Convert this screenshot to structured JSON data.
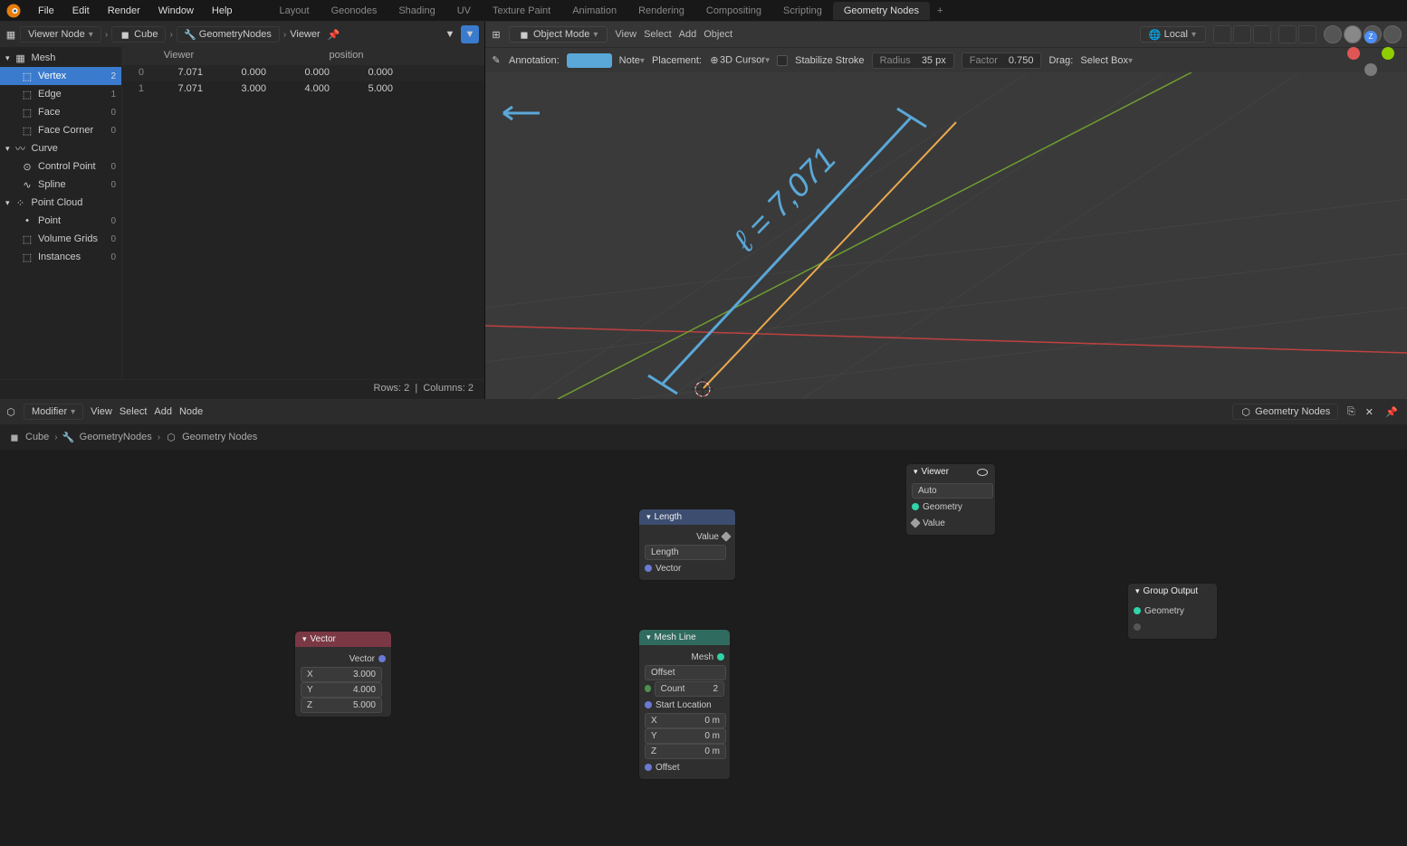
{
  "menu": {
    "items": [
      "File",
      "Edit",
      "Render",
      "Window",
      "Help"
    ]
  },
  "workspaces": {
    "tabs": [
      "Layout",
      "Geonodes",
      "Shading",
      "UV",
      "Texture Paint",
      "Animation",
      "Rendering",
      "Compositing",
      "Scripting",
      "Geometry Nodes"
    ],
    "active": 9
  },
  "spreadsheet": {
    "mode": "Viewer Node",
    "crumbs": [
      "Cube",
      "GeometryNodes",
      "Viewer"
    ],
    "tree": [
      {
        "label": "Mesh",
        "type": "cat"
      },
      {
        "label": "Vertex",
        "count": 2,
        "sel": true
      },
      {
        "label": "Edge",
        "count": 1
      },
      {
        "label": "Face",
        "count": 0
      },
      {
        "label": "Face Corner",
        "count": 0
      },
      {
        "label": "Curve",
        "type": "cat"
      },
      {
        "label": "Control Point",
        "count": 0
      },
      {
        "label": "Spline",
        "count": 0
      },
      {
        "label": "Point Cloud",
        "type": "cat"
      },
      {
        "label": "Point",
        "count": 0
      },
      {
        "label": "Volume Grids",
        "count": 0,
        "type": "solo"
      },
      {
        "label": "Instances",
        "count": 0,
        "type": "solo"
      }
    ],
    "columns": [
      "",
      "Viewer",
      "position"
    ],
    "rows": [
      {
        "i": 0,
        "viewer": "7.071",
        "x": "0.000",
        "y": "0.000",
        "z": "0.000"
      },
      {
        "i": 1,
        "viewer": "7.071",
        "x": "3.000",
        "y": "4.000",
        "z": "5.000"
      }
    ],
    "status": {
      "rows": "Rows: 2",
      "cols": "Columns: 2"
    }
  },
  "viewport": {
    "mode": "Object Mode",
    "menus": [
      "View",
      "Select",
      "Add",
      "Object"
    ],
    "orientation": "Local",
    "annotation": {
      "label": "Annotation:",
      "tool_label": "Note",
      "placement_label": "Placement:",
      "placement": "3D Cursor",
      "stabilize": "Stabilize Stroke",
      "radius_label": "Radius",
      "radius": "35 px",
      "factor_label": "Factor",
      "factor": "0.750",
      "drag_label": "Drag:",
      "drag": "Select Box"
    },
    "handwriting": "ℓ = 7,071"
  },
  "node_editor": {
    "mode": "Modifier",
    "menus": [
      "View",
      "Select",
      "Add",
      "Node"
    ],
    "tree_name": "Geometry Nodes",
    "crumbs": [
      "Cube",
      "GeometryNodes",
      "Geometry Nodes"
    ]
  },
  "nodes": {
    "vector": {
      "title": "Vector",
      "out": "Vector",
      "x": "3.000",
      "y": "4.000",
      "z": "5.000"
    },
    "length": {
      "title": "Length",
      "out": "Value",
      "op": "Length",
      "in": "Vector"
    },
    "meshline": {
      "title": "Mesh Line",
      "out": "Mesh",
      "mode": "Offset",
      "count_label": "Count",
      "count": "2",
      "start_label": "Start Location",
      "x": "0 m",
      "y": "0 m",
      "z": "0 m",
      "offset": "Offset",
      "x_l": "X",
      "y_l": "Y",
      "z_l": "Z"
    },
    "viewer": {
      "title": "Viewer",
      "mode": "Auto",
      "geo": "Geometry",
      "val": "Value"
    },
    "group_output": {
      "title": "Group Output",
      "geo": "Geometry"
    }
  }
}
